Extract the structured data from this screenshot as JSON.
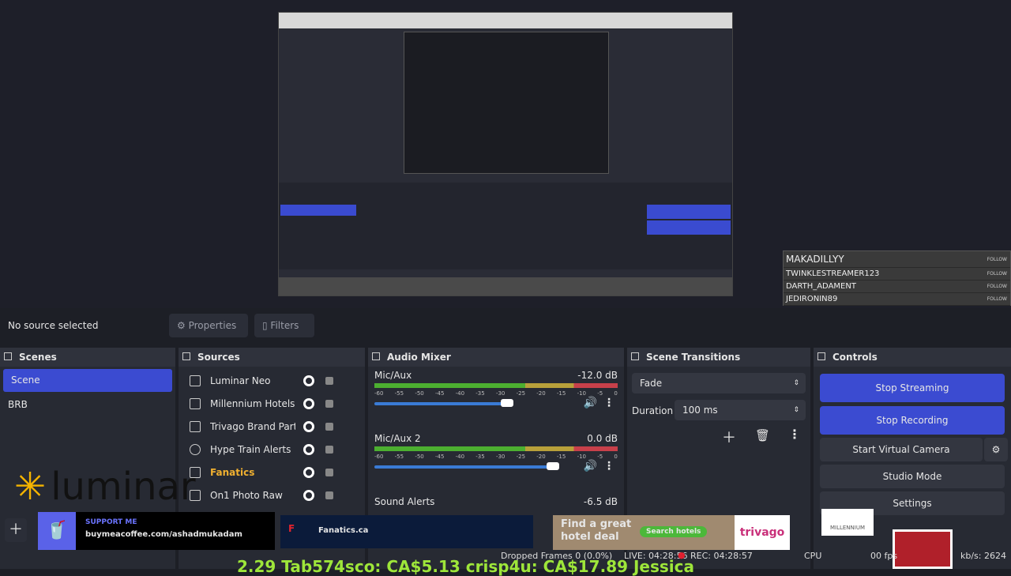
{
  "preview": {
    "followers": [
      {
        "name": "MAKADILLYY",
        "action": "FOLLOW"
      },
      {
        "name": "TWINKLESTREAMER123",
        "action": "FOLLOW"
      },
      {
        "name": "DARTH_ADAMENT",
        "action": "FOLLOW"
      },
      {
        "name": "JEDIRONIN89",
        "action": "FOLLOW"
      }
    ]
  },
  "source_toolbar": {
    "status": "No source selected",
    "properties": "Properties",
    "filters": "Filters"
  },
  "scenes": {
    "title": "Scenes",
    "items": [
      "Scene",
      "BRB"
    ],
    "selected": "Scene"
  },
  "sources": {
    "title": "Sources",
    "items": [
      "Luminar Neo",
      "Millennium Hotels",
      "Trivago Brand Part",
      "Hype Train Alerts",
      "Fanatics",
      "On1 Photo Raw"
    ]
  },
  "mixer": {
    "title": "Audio Mixer",
    "channels": [
      {
        "name": "Mic/Aux",
        "db": "-12.0 dB",
        "volume": 0.75
      },
      {
        "name": "Mic/Aux 2",
        "db": "0.0 dB",
        "volume": 1.0
      },
      {
        "name": "Sound Alerts",
        "db": "-6.5 dB"
      }
    ],
    "ticks": [
      "-60",
      "-55",
      "-50",
      "-45",
      "-40",
      "-35",
      "-30",
      "-25",
      "-20",
      "-15",
      "-10",
      "-5",
      "0"
    ]
  },
  "transitions": {
    "title": "Scene Transitions",
    "type": "Fade",
    "duration_label": "Duration",
    "duration": "100 ms"
  },
  "controls": {
    "title": "Controls",
    "stop_streaming": "Stop Streaming",
    "stop_recording": "Stop Recording",
    "virtual_camera": "Start Virtual Camera",
    "studio_mode": "Studio Mode",
    "settings": "Settings"
  },
  "overlay": {
    "luminar": "luminar",
    "support_title": "SUPPORT ME",
    "support_url": "buymeacoffee.com/ashadmukadam",
    "fanatics": "Fanatics.ca",
    "trivago_text": "Find a great hotel deal",
    "trivago_btn": "Search hotels",
    "trivago": "trivago",
    "millennium": "MILLENNIUM",
    "ticker": "2.29   Tab574sco: CA$5.13   crisp4u: CA$17.89   Jessica"
  },
  "status": {
    "dropped": "Dropped Frames 0 (0.0%)",
    "live": "LIVE: 04:28:56",
    "rec": "REC: 04:28:57",
    "cpu": "CPU",
    "fps": "00 fps",
    "kbs": "kb/s: 2624"
  },
  "colors": {
    "accent": "#3b4bd1",
    "panel": "#272a33",
    "bg": "#1d1f26"
  }
}
